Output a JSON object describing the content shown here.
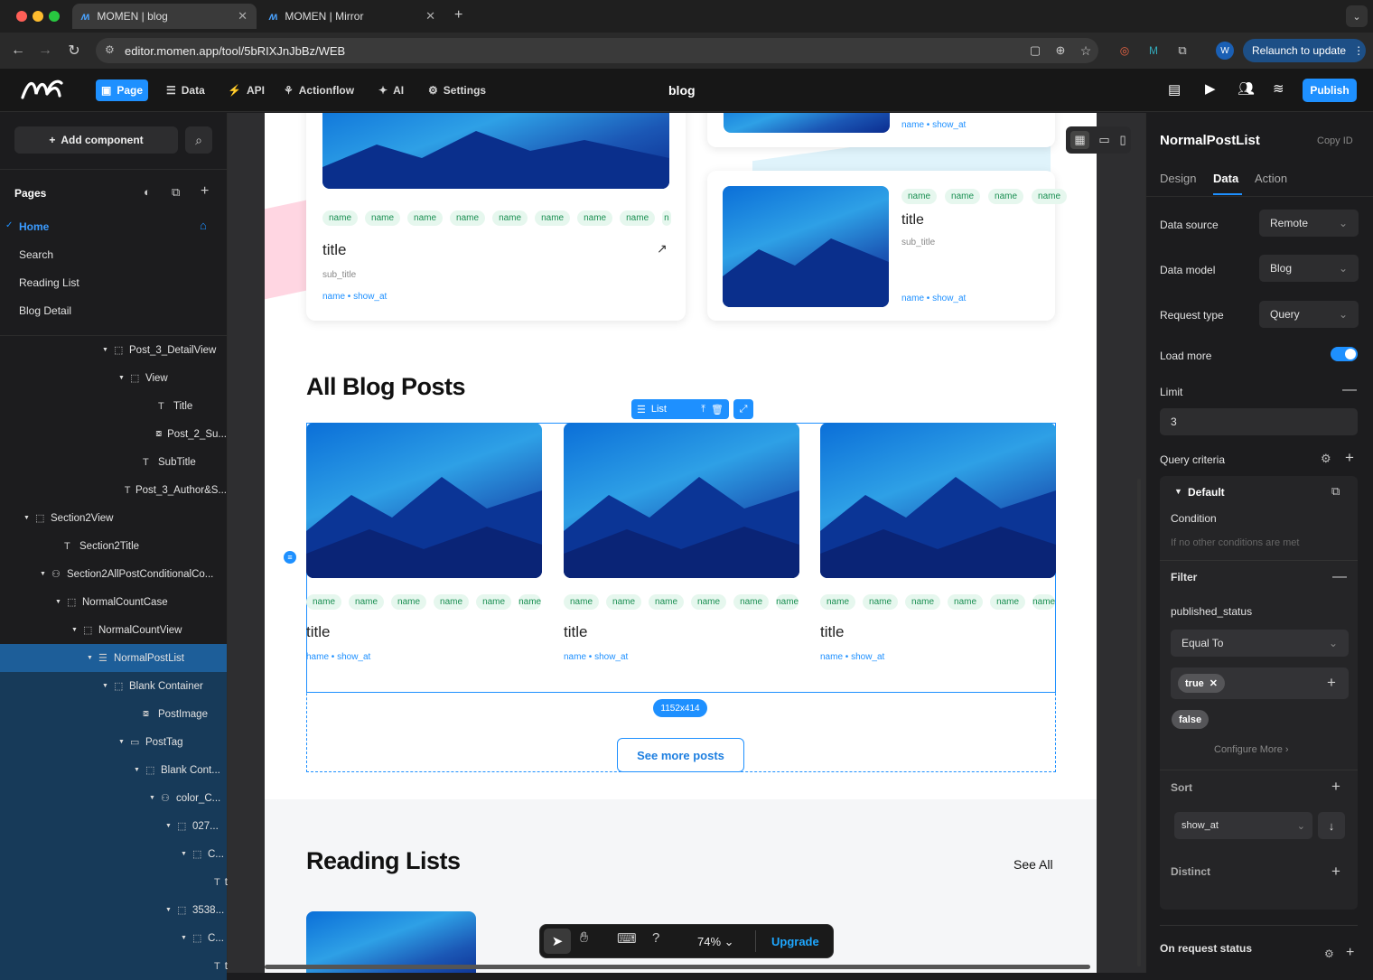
{
  "browser": {
    "tabs": [
      {
        "label": "MOMEN | blog"
      },
      {
        "label": "MOMEN | Mirror"
      }
    ],
    "url": "editor.momen.app/tool/5bRIXJnJbBz/WEB",
    "relaunch": "Relaunch to update",
    "profile": "W"
  },
  "header": {
    "menu": {
      "page": "Page",
      "data": "Data",
      "api": "API",
      "actionflow": "Actionflow",
      "ai": "AI",
      "settings": "Settings"
    },
    "project": "blog",
    "publish": "Publish"
  },
  "left": {
    "add_component": "Add component",
    "pages_label": "Pages",
    "pages": [
      "Home",
      "Search",
      "Reading List",
      "Blog Detail"
    ],
    "tree": [
      {
        "label": "Post_3_DetailView",
        "indent": 113,
        "icon": "container"
      },
      {
        "label": "View",
        "indent": 131,
        "icon": "container"
      },
      {
        "label": "Title",
        "indent": 162,
        "icon": "text"
      },
      {
        "label": "Post_2_Su...",
        "indent": 162,
        "icon": "image"
      },
      {
        "label": "SubTitle",
        "indent": 145,
        "icon": "text"
      },
      {
        "label": "Post_3_Author&S...",
        "indent": 128,
        "icon": "text"
      },
      {
        "label": "Section2View",
        "indent": 26,
        "icon": "container"
      },
      {
        "label": "Section2Title",
        "indent": 58,
        "icon": "text"
      },
      {
        "label": "Section2AllPostConditionalCo...",
        "indent": 44,
        "icon": "conditional"
      },
      {
        "label": "NormalCountCase",
        "indent": 61,
        "icon": "container"
      },
      {
        "label": "NormalCountView",
        "indent": 79,
        "icon": "container"
      },
      {
        "label": "NormalPostList",
        "indent": 96,
        "icon": "list"
      },
      {
        "label": "Blank Container",
        "indent": 113,
        "icon": "container"
      },
      {
        "label": "PostImage",
        "indent": 145,
        "icon": "image"
      },
      {
        "label": "PostTag",
        "indent": 131,
        "icon": "tag"
      },
      {
        "label": "Blank Cont...",
        "indent": 148,
        "icon": "container"
      },
      {
        "label": "color_C...",
        "indent": 165,
        "icon": "conditional"
      },
      {
        "label": "027...",
        "indent": 183,
        "icon": "container"
      },
      {
        "label": "C...",
        "indent": 200,
        "icon": "container"
      },
      {
        "label": "t",
        "indent": 232,
        "icon": "text"
      },
      {
        "label": "3538...",
        "indent": 183,
        "icon": "container"
      },
      {
        "label": "C...",
        "indent": 200,
        "icon": "container"
      },
      {
        "label": "t",
        "indent": 232,
        "icon": "text"
      }
    ]
  },
  "canvas": {
    "tag": "name",
    "title": "title",
    "subtitle": "sub_title",
    "meta": "name • show_at",
    "meta_cut": "hame • show_at",
    "section_title": "All Blog Posts",
    "list_badge": "List",
    "size_badge": "1152x414",
    "see_more": "See more posts",
    "reading_title": "Reading Lists",
    "see_all": "See All",
    "tag_cut": "n"
  },
  "bottom_toolbar": {
    "zoom": "74%",
    "upgrade": "Upgrade"
  },
  "right": {
    "component": "NormalPostList",
    "copy_id": "Copy ID",
    "tabs": [
      "Design",
      "Data",
      "Action"
    ],
    "data_source_label": "Data source",
    "data_source": "Remote",
    "data_model_label": "Data model",
    "data_model": "Blog",
    "request_type_label": "Request type",
    "request_type": "Query",
    "load_more_label": "Load more",
    "limit_label": "Limit",
    "limit": "3",
    "query_criteria_label": "Query criteria",
    "default_label": "Default",
    "condition_label": "Condition",
    "condition_text": "If no other conditions are met",
    "filter_label": "Filter",
    "filter_field": "published_status",
    "operator": "Equal To",
    "value_true": "true",
    "value_false": "false",
    "configure_more": "Configure More",
    "sort_label": "Sort",
    "sort_field": "show_at",
    "distinct_label": "Distinct",
    "on_request_status": "On request status"
  },
  "colors": {
    "accent": "#1e90ff",
    "tag_green": "#1a8f52",
    "panel": "#1c1c1e"
  }
}
